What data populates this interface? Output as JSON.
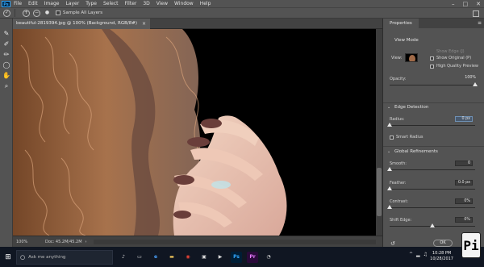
{
  "app": {
    "logo": "Ps",
    "menu": [
      "File",
      "Edit",
      "Image",
      "Layer",
      "Type",
      "Select",
      "Filter",
      "3D",
      "View",
      "Window",
      "Help"
    ],
    "window_controls": [
      "–",
      "□",
      "✕"
    ]
  },
  "options_bar": {
    "sample_all_layers": "Sample All Layers",
    "sample_checked": false
  },
  "document": {
    "tab_title": "beautiful-2819394.jpg @ 100% (Background, RGB/8#)",
    "close": "×",
    "zoom": "100%",
    "doc_size": "Doc: 45.2M/45.2M",
    "status_arrow": "›"
  },
  "properties": {
    "title": "Properties",
    "menu": "≡",
    "view_mode_heading": "View Mode",
    "view_label": "View:",
    "show_edge": "Show Edge (J)",
    "show_original": "Show Original (P)",
    "high_quality_preview": "High Quality Preview",
    "opacity_label": "Opacity:",
    "opacity_value": "100%",
    "opacity_level": 1.0,
    "edge_detection_heading": "Edge Detection",
    "radius_label": "Radius:",
    "radius_value": "0 px",
    "radius_level": 0.0,
    "smart_radius": "Smart Radius",
    "global_refinements_heading": "Global Refinements",
    "smooth_label": "Smooth:",
    "smooth_value": "0",
    "smooth_level": 0.0,
    "feather_label": "Feather:",
    "feather_value": "0.0 px",
    "feather_level": 0.0,
    "contrast_label": "Contrast:",
    "contrast_value": "0%",
    "contrast_level": 0.0,
    "shift_edge_label": "Shift Edge:",
    "shift_edge_value": "0%",
    "shift_edge_level": 0.5,
    "ok_label": "OK"
  },
  "taskbar": {
    "search_placeholder": "Ask me anything",
    "apps": [
      {
        "name": "Ps",
        "bg": "#001e36",
        "fg": "#31a8ff"
      },
      {
        "name": "Pr",
        "bg": "#2a0a3a",
        "fg": "#e77bff"
      }
    ],
    "time": "10:28 PM",
    "date": "10/28/2017"
  },
  "watermark": "Pi",
  "colors": {
    "panel": "#535353",
    "canvas_bg": "#000000",
    "taskbar": "#101622",
    "accent": "#6e8fb3"
  }
}
